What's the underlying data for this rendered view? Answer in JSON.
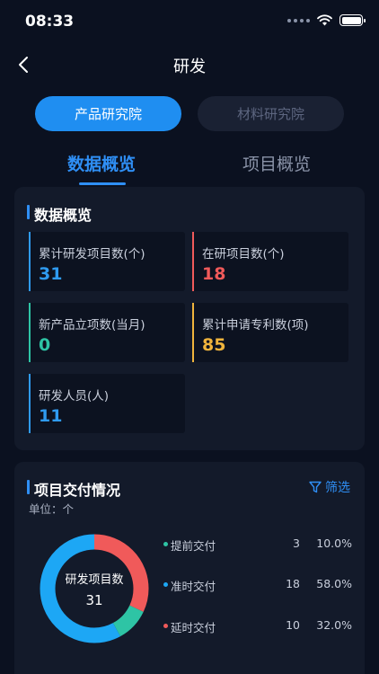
{
  "status_bar": {
    "time": "08:33"
  },
  "nav": {
    "title": "研发"
  },
  "segments": {
    "active": "产品研究院",
    "inactive": "材料研究院"
  },
  "tabs": {
    "active": "数据概览",
    "inactive": "项目概览"
  },
  "overview": {
    "title": "数据概览",
    "stats": [
      {
        "label": "累计研发项目数(个)",
        "value": "31",
        "color": "#2f9bf0"
      },
      {
        "label": "在研项目数(个)",
        "value": "18",
        "color": "#f05a5a"
      },
      {
        "label": "新产品立项数(当月)",
        "value": "0",
        "color": "#2ec4a5"
      },
      {
        "label": "累计申请专利数(项)",
        "value": "85",
        "color": "#f0b43c"
      },
      {
        "label": "研发人员(人)",
        "value": "11",
        "color": "#2f9bf0"
      }
    ]
  },
  "delivery": {
    "title": "项目交付情况",
    "filter_label": "筛选",
    "unit": "单位：个",
    "center_label": "研发项目数",
    "center_value": "31",
    "items": [
      {
        "name": "提前交付",
        "count": "3",
        "percent": "10.0%",
        "share": 0.1,
        "color": "#2ec4a5"
      },
      {
        "name": "准时交付",
        "count": "18",
        "percent": "58.0%",
        "share": 0.58,
        "color": "#1da7f5"
      },
      {
        "name": "延时交付",
        "count": "10",
        "percent": "32.0%",
        "share": 0.32,
        "color": "#f05a5a"
      }
    ]
  }
}
